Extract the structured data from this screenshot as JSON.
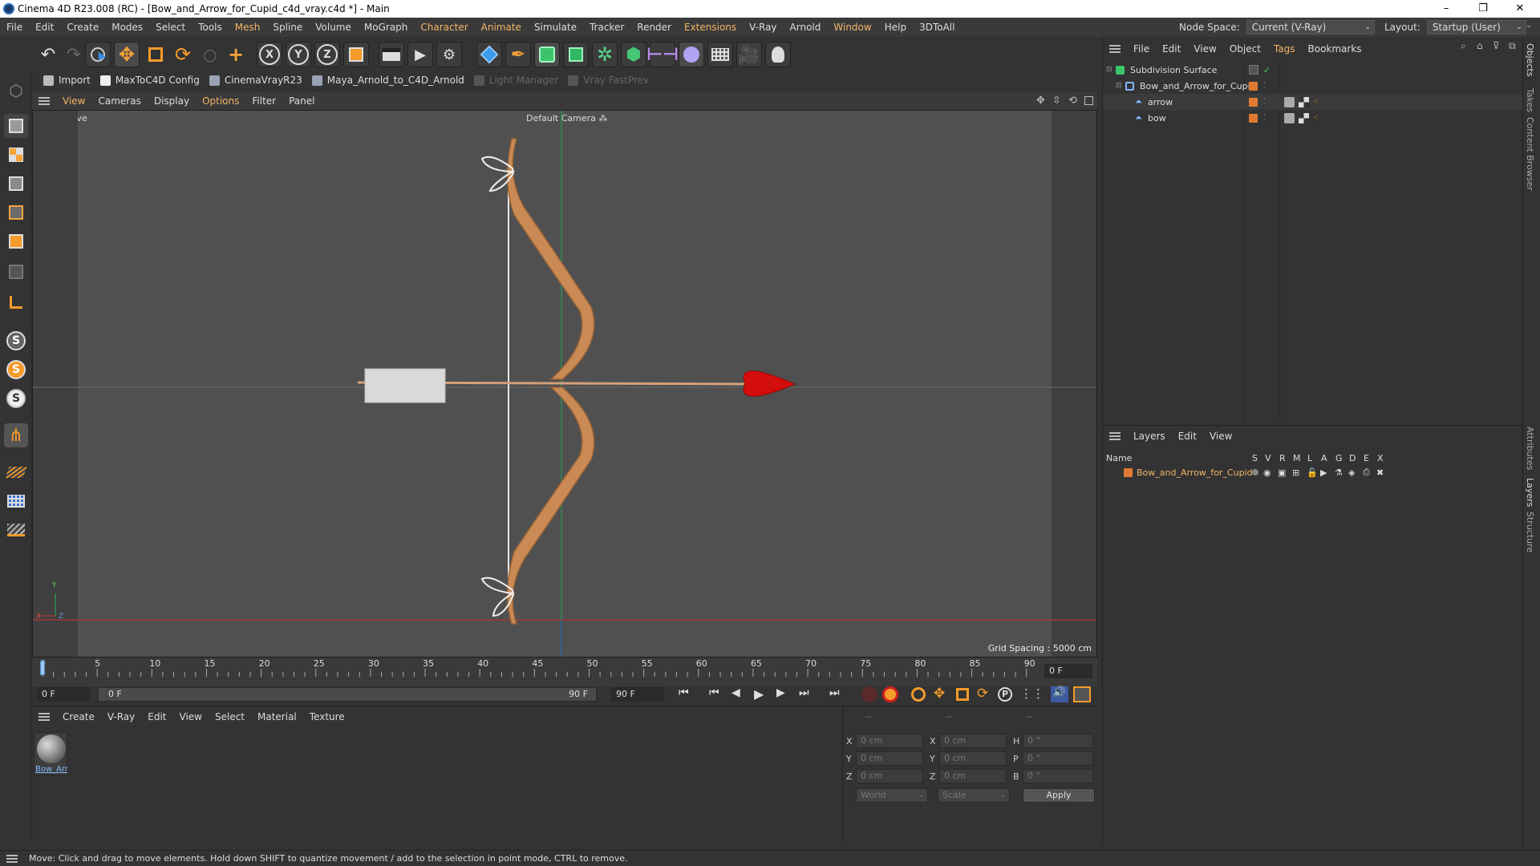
{
  "window": {
    "title": "Cinema 4D R23.008 (RC) - [Bow_and_Arrow_for_Cupid_c4d_vray.c4d *] - Main",
    "min": "–",
    "restore": "❐",
    "close": "✕"
  },
  "menu": {
    "items": [
      "File",
      "Edit",
      "Create",
      "Modes",
      "Select",
      "Tools",
      "Mesh",
      "Spline",
      "Volume",
      "MoGraph",
      "Character",
      "Animate",
      "Simulate",
      "Tracker",
      "Render",
      "Extensions",
      "V-Ray",
      "Arnold",
      "Window",
      "Help",
      "3DToAll"
    ],
    "node_space_label": "Node Space:",
    "node_space_value": "Current (V-Ray)",
    "layout_label": "Layout:",
    "layout_value": "Startup (User)"
  },
  "plugins": {
    "items": [
      "Import",
      "MaxToC4D Config",
      "CinemaVrayR23",
      "Maya_Arnold_to_C4D_Arnold",
      "Light Manager",
      "Vray FastPrev"
    ]
  },
  "viewport": {
    "menu": [
      "View",
      "Cameras",
      "Display",
      "Options",
      "Filter",
      "Panel"
    ],
    "label": "Perspective",
    "camera": "Default Camera",
    "grid_spacing": "Grid Spacing : 5000 cm",
    "axis_y": "Y",
    "axis_x": "X",
    "axis_z": "Z"
  },
  "timeline": {
    "ticks": [
      "0",
      "5",
      "10",
      "15",
      "20",
      "25",
      "30",
      "35",
      "40",
      "45",
      "50",
      "55",
      "60",
      "65",
      "70",
      "75",
      "80",
      "85",
      "90"
    ],
    "current_frame": "0 F",
    "start": "0 F",
    "range_start": "0 F",
    "range_end": "90 F",
    "end": "90 F"
  },
  "material_panel": {
    "menu": [
      "Create",
      "V-Ray",
      "Edit",
      "View",
      "Select",
      "Material",
      "Texture"
    ],
    "material_name": "Bow_Arr"
  },
  "coords": {
    "header_a": "--",
    "header_b": "--",
    "header_c": "--",
    "x": "X",
    "y": "Y",
    "z": "Z",
    "h": "H",
    "p": "P",
    "b": "B",
    "pos_x": "0 cm",
    "pos_y": "0 cm",
    "pos_z": "0 cm",
    "size_x": "0 cm",
    "size_y": "0 cm",
    "size_z": "0 cm",
    "rot_h": "0 °",
    "rot_p": "0 °",
    "rot_b": "0 °",
    "world": "World",
    "scale": "Scale",
    "apply": "Apply"
  },
  "objects": {
    "menu": [
      "File",
      "Edit",
      "View",
      "Object",
      "Tags",
      "Bookmarks"
    ],
    "tree": [
      {
        "name": "Subdivision Surface"
      },
      {
        "name": "Bow_and_Arrow_for_Cupid"
      },
      {
        "name": "arrow"
      },
      {
        "name": "bow"
      }
    ]
  },
  "layers": {
    "menu": [
      "Layers",
      "Edit",
      "View"
    ],
    "col_name": "Name",
    "cols": [
      "S",
      "V",
      "R",
      "M",
      "L",
      "A",
      "G",
      "D",
      "E",
      "X"
    ],
    "row": "Bow_and_Arrow_for_Cupid"
  },
  "sidetabs": [
    "Objects",
    "Takes",
    "Content Browser",
    "Attributes",
    "Layers",
    "Structure"
  ],
  "status": "Move: Click and drag to move elements. Hold down SHIFT to quantize movement / add to the selection in point mode, CTRL to remove.",
  "colors": {
    "accent": "#f3b566",
    "layer": "#e07a33",
    "heart": "#d40d0d",
    "bow": "#c98a55"
  }
}
